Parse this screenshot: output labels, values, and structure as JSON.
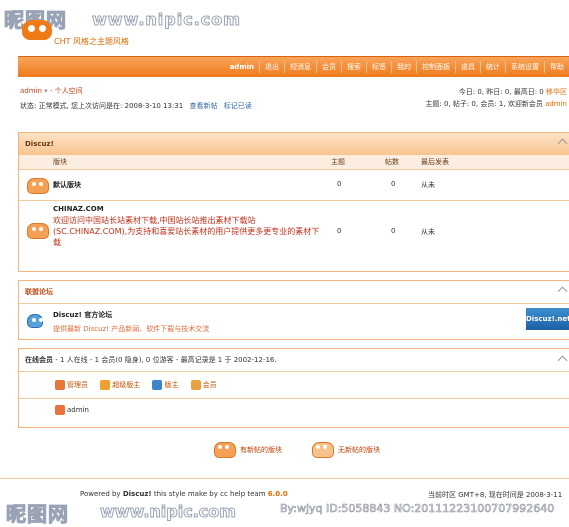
{
  "watermark": {
    "logo": "昵图网",
    "url": "www.nipic.com",
    "bottom_url": "www.nipic.com",
    "id_text": "By:wjyq     ID:5058843 NO:20111223100707992640"
  },
  "brand": {
    "subtitle": "CHT 风格之主题风格"
  },
  "nav": {
    "items": [
      "admin",
      "退出",
      "短消息",
      "会员",
      "搜索",
      "标签",
      "我的",
      "控制面板",
      "道具",
      "统计",
      "系统设置",
      "帮助"
    ]
  },
  "user_info": {
    "line1_user": "admin",
    "line1_arrow": "▾",
    "line1_text": "- 个人空间",
    "status_text": "状态: 正常模式, 您上次访问是在: 2008-3-10 13:31",
    "link_new": "查看新帖",
    "link_mark": "标记已读",
    "right_line1": "今日: 0, 昨日: 0, 最高日: 0",
    "right_line1_link": "移华区",
    "right_line2": "主题: 0, 帖子: 0, 会员: 1, 欢迎新会员",
    "right_line2_user": "admin"
  },
  "forum_box": {
    "title": "Discuz!",
    "columns": [
      "版块",
      "主题",
      "帖数",
      "最后发表"
    ],
    "rows": [
      {
        "name": "默认版块",
        "topics": "0",
        "posts": "0",
        "last": "从未",
        "desc": ""
      },
      {
        "name": "CHINAZ.COM",
        "topics": "0",
        "posts": "0",
        "last": "从未",
        "desc": "欢迎访问中国站长站素材下载,中国站长站推出素材下载站(SC.CHINAZ.COM),为支持和喜爱站长素材的用户提供更多更专业的素材下载"
      }
    ]
  },
  "links_box": {
    "title": "联盟论坛",
    "item_name": "Discuz! 官方论坛",
    "item_desc": "提供最新 Discuz! 产品新闻、软件下载与技术交流",
    "badge": "Discuz!.net"
  },
  "online_box": {
    "title": "在线会员",
    "summary": "- 1 人在线 - 1 会员(0 隐身), 0 位游客 - 最高记录是 1 于  2002-12-16.",
    "roles": [
      "管理员",
      "超级版主",
      "版主",
      "会员"
    ],
    "role_colors": [
      "#e8743b",
      "#f0a030",
      "#3a86c8",
      "#e8a340"
    ],
    "online_user": "admin"
  },
  "legend": {
    "new_posts": "有新帖的版块",
    "no_new_posts": "无新帖的版块"
  },
  "footer": {
    "powered": "Powered by",
    "product": "Discuz!",
    "theme_text": "this style make by cc help team",
    "version": "6.0.0",
    "timezone": "当前时区 GMT+8, 现在时间是 2008-3-11"
  }
}
